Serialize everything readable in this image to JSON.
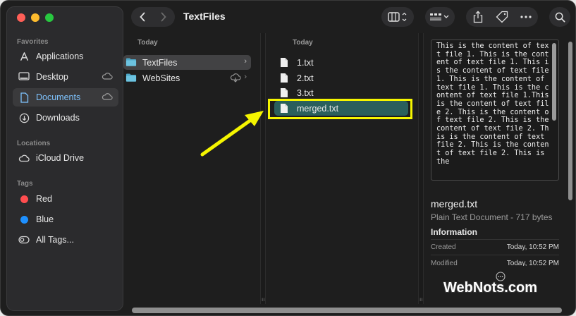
{
  "window": {
    "title": "TextFiles"
  },
  "colors": {
    "accent": "#7fc4ff",
    "selection": "#2a5f5c",
    "highlight": "#f5f500",
    "red_tag": "#ff4d4f",
    "blue_tag": "#1e90ff"
  },
  "sidebar": {
    "favorites_heading": "Favorites",
    "favorites": [
      {
        "label": "Applications",
        "icon": "applications-icon"
      },
      {
        "label": "Desktop",
        "icon": "desktop-icon"
      },
      {
        "label": "Documents",
        "icon": "document-icon",
        "active": true
      },
      {
        "label": "Downloads",
        "icon": "download-icon"
      }
    ],
    "locations_heading": "Locations",
    "locations": [
      {
        "label": "iCloud Drive",
        "icon": "cloud-icon"
      }
    ],
    "tags_heading": "Tags",
    "tags": [
      {
        "label": "Red",
        "color": "#ff4d4f"
      },
      {
        "label": "Blue",
        "color": "#1e90ff"
      },
      {
        "label": "All Tags...",
        "icon": "all-tags-icon"
      }
    ]
  },
  "column1": {
    "heading": "Today",
    "items": [
      {
        "label": "TextFiles",
        "selected": true
      },
      {
        "label": "WebSites"
      }
    ]
  },
  "column2": {
    "heading": "Today",
    "items": [
      {
        "label": "1.txt"
      },
      {
        "label": "2.txt"
      },
      {
        "label": "3.txt"
      },
      {
        "label": "merged.txt",
        "selected": true
      }
    ]
  },
  "preview": {
    "content": "This is the content of text file 1. This is the content of text file 1. This is the content of text file 1. This is the content of text file 1. This is the content of text file 1.This is the content of text file 2. This is the content of text file 2. This is the content of text file 2. This is the content of text file 2. This is the content of text file 2. This is the",
    "filename": "merged.txt",
    "kind": "Plain Text Document - 717 bytes",
    "info_heading": "Information",
    "created_label": "Created",
    "created_value": "Today, 10:52 PM",
    "modified_label": "Modified",
    "modified_value": "Today, 10:52 PM",
    "more_icon": "ellipsis-circle-icon"
  },
  "watermark": "WebNots.com"
}
